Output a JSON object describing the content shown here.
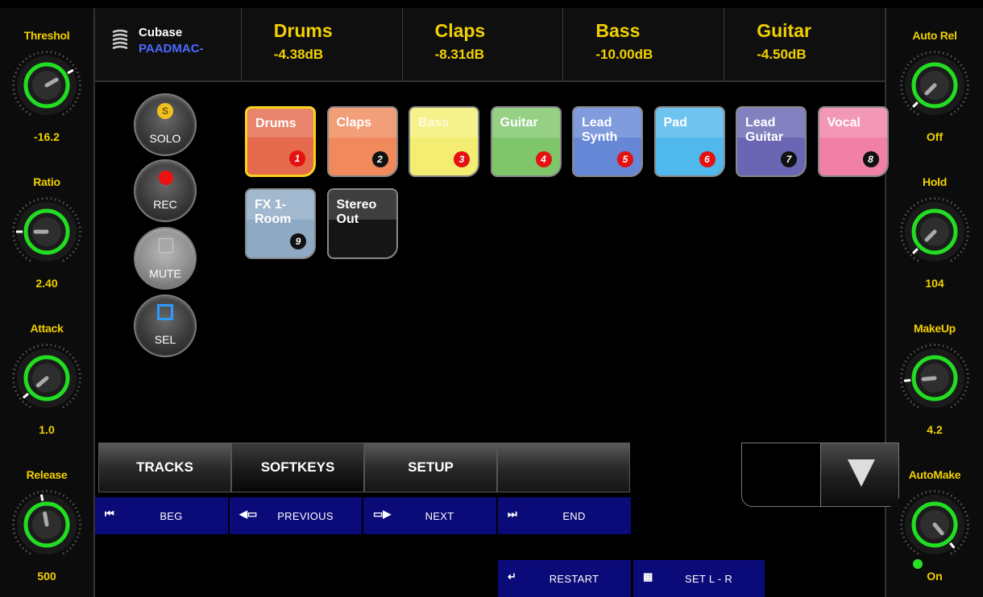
{
  "colors": {
    "accent": "#f2d100",
    "host_line2": "#4a6bff",
    "transport_bg": "#0a0a78",
    "knob_ring": "#22dd22"
  },
  "left_knobs": [
    {
      "label": "Threshol",
      "value": "-16.2"
    },
    {
      "label": "Ratio",
      "value": "2.40"
    },
    {
      "label": "Attack",
      "value": "1.0"
    },
    {
      "label": "Release",
      "value": "500"
    }
  ],
  "right_knobs": [
    {
      "label": "Auto Rel",
      "value": "Off"
    },
    {
      "label": "Hold",
      "value": "104"
    },
    {
      "label": "MakeUp",
      "value": "4.2"
    },
    {
      "label": "AutoMake",
      "value": "On"
    }
  ],
  "header": {
    "host_name": "Cubase",
    "host_device": "PAADMAC-",
    "tracks": [
      {
        "name": "Drums",
        "level": "-4.38dB"
      },
      {
        "name": "Claps",
        "level": "-8.31dB"
      },
      {
        "name": "Bass",
        "level": "-10.00dB"
      },
      {
        "name": "Guitar",
        "level": "-4.50dB"
      }
    ]
  },
  "buttons": {
    "solo": "SOLO",
    "solo_badge": "S",
    "rec": "REC",
    "mute": "MUTE",
    "sel": "SEL"
  },
  "track_grid": [
    {
      "name": "Drums",
      "number": "1",
      "color": "#e56a4e",
      "badge": "red"
    },
    {
      "name": "Claps",
      "number": "2",
      "color": "#f08a5c",
      "badge": "blk"
    },
    {
      "name": "Bass",
      "number": "3",
      "color": "#f3ee72",
      "badge": "red"
    },
    {
      "name": "Guitar",
      "number": "4",
      "color": "#7fc66b",
      "badge": "red"
    },
    {
      "name": "Lead Synth",
      "number": "5",
      "color": "#6587d6",
      "badge": "red"
    },
    {
      "name": "Pad",
      "number": "6",
      "color": "#4fb8ec",
      "badge": "red"
    },
    {
      "name": "Lead Guitar",
      "number": "7",
      "color": "#6a66b4",
      "badge": "blk"
    },
    {
      "name": "Vocal",
      "number": "8",
      "color": "#f080a6",
      "badge": "blk"
    },
    {
      "name": "FX 1-Room",
      "number": "9",
      "color": "#8ea9c4",
      "badge": "blk"
    },
    {
      "name": "Stereo Out",
      "number": "",
      "color": "#151515",
      "badge": ""
    }
  ],
  "tabs": [
    "TRACKS",
    "SOFTKEYS",
    "SETUP",
    ""
  ],
  "transport": {
    "beg": "BEG",
    "previous": "PREVIOUS",
    "next": "NEXT",
    "end": "END",
    "restart": "RESTART",
    "set_lr": "SET  L - R"
  }
}
